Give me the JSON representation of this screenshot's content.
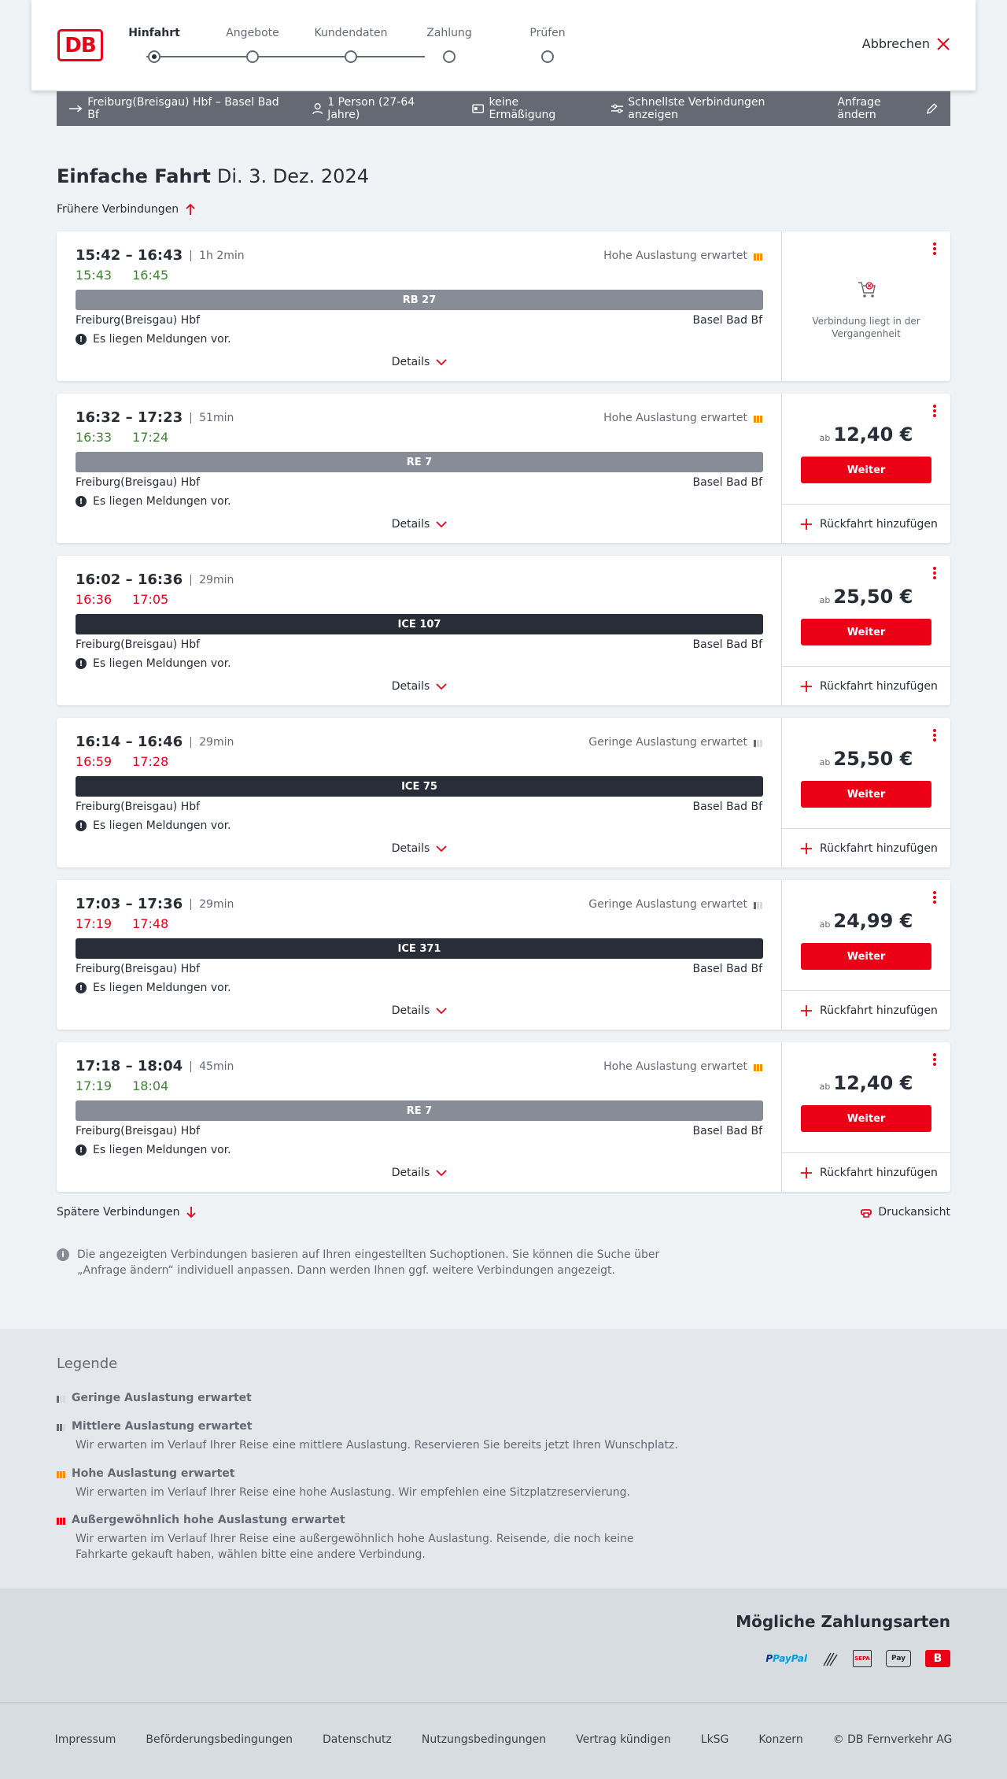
{
  "header": {
    "logo": "DB",
    "steps": [
      {
        "label": "Hinfahrt",
        "active": true
      },
      {
        "label": "Angebote",
        "active": false
      },
      {
        "label": "Kundendaten",
        "active": false
      },
      {
        "label": "Zahlung",
        "active": false
      },
      {
        "label": "Prüfen",
        "active": false
      }
    ],
    "cancel_label": "Abbrechen"
  },
  "search": {
    "route": "Freiburg(Breisgau) Hbf – Basel Bad Bf",
    "passengers": "1 Person (27-64 Jahre)",
    "discount": "keine Ermäßigung",
    "fastest": "Schnellste Verbindungen anzeigen",
    "edit": "Anfrage ändern"
  },
  "page": {
    "title": "Einfache Fahrt",
    "date": "Di. 3. Dez. 2024",
    "earlier": "Frühere Verbindungen",
    "later": "Spätere Verbindungen",
    "print": "Druckansicht",
    "info": "Die angezeigten Verbindungen basieren auf Ihren eingestellten Suchoptionen. Sie können die Suche über „Anfrage ändern“ individuell anpassen. Dann werden Ihnen ggf. weitere Verbindungen angezeigt."
  },
  "connections": [
    {
      "times": "15:42 – 16:43",
      "duration": "1h 2min",
      "rt_dep": "15:43",
      "rt_arr": "16:45",
      "delayed": false,
      "occupancy": "Hohe Auslastung erwartet",
      "occ_level": "high",
      "train": "RB 27",
      "train_type": "reg",
      "from": "Freiburg(Breisgau) Hbf",
      "to": "Basel Bad Bf",
      "message": "Es liegen Meldungen vor.",
      "details": "Details",
      "past": true,
      "past_text": "Verbindung liegt in der Vergangenheit"
    },
    {
      "times": "16:32 – 17:23",
      "duration": "51min",
      "rt_dep": "16:33",
      "rt_arr": "17:24",
      "delayed": false,
      "occupancy": "Hohe Auslastung erwartet",
      "occ_level": "high",
      "train": "RE 7",
      "train_type": "reg",
      "from": "Freiburg(Breisgau) Hbf",
      "to": "Basel Bad Bf",
      "message": "Es liegen Meldungen vor.",
      "details": "Details",
      "price_prefix": "ab",
      "price": "12,40 €",
      "button": "Weiter",
      "return": "Rückfahrt hinzufügen"
    },
    {
      "times": "16:02 – 16:36",
      "duration": "29min",
      "rt_dep": "16:36",
      "rt_arr": "17:05",
      "delayed": true,
      "occupancy": "",
      "occ_level": "",
      "train": "ICE 107",
      "train_type": "ice",
      "from": "Freiburg(Breisgau) Hbf",
      "to": "Basel Bad Bf",
      "message": "Es liegen Meldungen vor.",
      "details": "Details",
      "price_prefix": "ab",
      "price": "25,50 €",
      "button": "Weiter",
      "return": "Rückfahrt hinzufügen"
    },
    {
      "times": "16:14 – 16:46",
      "duration": "29min",
      "rt_dep": "16:59",
      "rt_arr": "17:28",
      "delayed": true,
      "occupancy": "Geringe Auslastung erwartet",
      "occ_level": "low",
      "train": "ICE 75",
      "train_type": "ice",
      "from": "Freiburg(Breisgau) Hbf",
      "to": "Basel Bad Bf",
      "message": "Es liegen Meldungen vor.",
      "details": "Details",
      "price_prefix": "ab",
      "price": "25,50 €",
      "button": "Weiter",
      "return": "Rückfahrt hinzufügen"
    },
    {
      "times": "17:03 – 17:36",
      "duration": "29min",
      "rt_dep": "17:19",
      "rt_arr": "17:48",
      "delayed": true,
      "occupancy": "Geringe Auslastung erwartet",
      "occ_level": "low",
      "train": "ICE 371",
      "train_type": "ice",
      "from": "Freiburg(Breisgau) Hbf",
      "to": "Basel Bad Bf",
      "message": "Es liegen Meldungen vor.",
      "details": "Details",
      "price_prefix": "ab",
      "price": "24,99 €",
      "button": "Weiter",
      "return": "Rückfahrt hinzufügen"
    },
    {
      "times": "17:18 – 18:04",
      "duration": "45min",
      "rt_dep": "17:19",
      "rt_arr": "18:04",
      "delayed": false,
      "occupancy": "Hohe Auslastung erwartet",
      "occ_level": "high",
      "train": "RE 7",
      "train_type": "reg",
      "from": "Freiburg(Breisgau) Hbf",
      "to": "Basel Bad Bf",
      "message": "Es liegen Meldungen vor.",
      "details": "Details",
      "price_prefix": "ab",
      "price": "12,40 €",
      "button": "Weiter",
      "return": "Rückfahrt hinzufügen"
    }
  ],
  "legend": {
    "title": "Legende",
    "items": [
      {
        "title": "Geringe Auslastung erwartet",
        "desc": ""
      },
      {
        "title": "Mittlere Auslastung erwartet",
        "desc": "Wir erwarten im Verlauf Ihrer Reise eine mittlere Auslastung. Reservieren Sie bereits jetzt Ihren Wunschplatz."
      },
      {
        "title": "Hohe Auslastung erwartet",
        "desc": "Wir erwarten im Verlauf Ihrer Reise eine hohe Auslastung. Wir empfehlen eine Sitzplatzreservierung."
      },
      {
        "title": "Außergewöhnlich hohe Auslastung erwartet",
        "desc": "Wir erwarten im Verlauf Ihrer Reise eine außergewöhnlich hohe Auslastung. Reisende, die noch keine Fahrkarte gekauft haben, wählen bitte eine andere Verbindung."
      }
    ]
  },
  "payment": {
    "title": "Mögliche Zahlungsarten",
    "methods": [
      "PayPal",
      "SEPA",
      "Pay"
    ]
  },
  "footer": {
    "links": [
      "Impressum",
      "Beförderungsbedingungen",
      "Datenschutz",
      "Nutzungsbedingungen",
      "Vertrag kündigen",
      "LkSG",
      "Konzern",
      "© DB Fernverkehr AG"
    ]
  },
  "colors": {
    "accent": "#ec0016",
    "dark": "#282d37",
    "on_time": "#408335",
    "high_occupancy": "#f39200"
  }
}
